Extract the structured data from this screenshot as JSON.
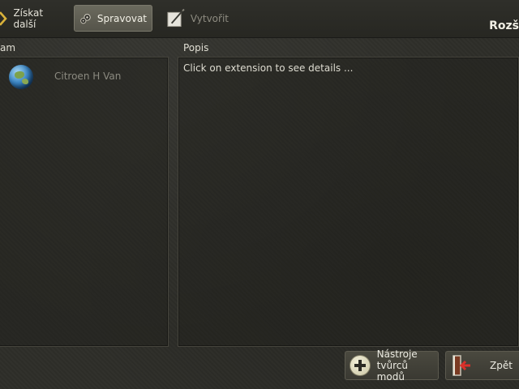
{
  "toolbar": {
    "tabs": [
      {
        "label": "Získat další",
        "icon": "chevron-arrow-icon",
        "state": "normal"
      },
      {
        "label": "Spravovat",
        "icon": "gears-icon",
        "state": "active"
      },
      {
        "label": "Vytvořit",
        "icon": "pen-paper-icon",
        "state": "disabled"
      }
    ],
    "title": "Rozš"
  },
  "list_panel": {
    "header": "am",
    "items": [
      {
        "label": "Citroen H Van",
        "icon": "globe-icon"
      }
    ]
  },
  "description_panel": {
    "header": "Popis",
    "text": "Click on extension to see details ..."
  },
  "buttons": {
    "tools": {
      "line1": "Nástroje",
      "line2": "tvůrců modů",
      "icon": "plus-circle-icon"
    },
    "back": {
      "label": "Zpět",
      "icon": "exit-door-icon"
    }
  },
  "colors": {
    "background": "#2e2e29",
    "active_tab": "#5f5e53",
    "exit_arrow": "#d9302a"
  }
}
